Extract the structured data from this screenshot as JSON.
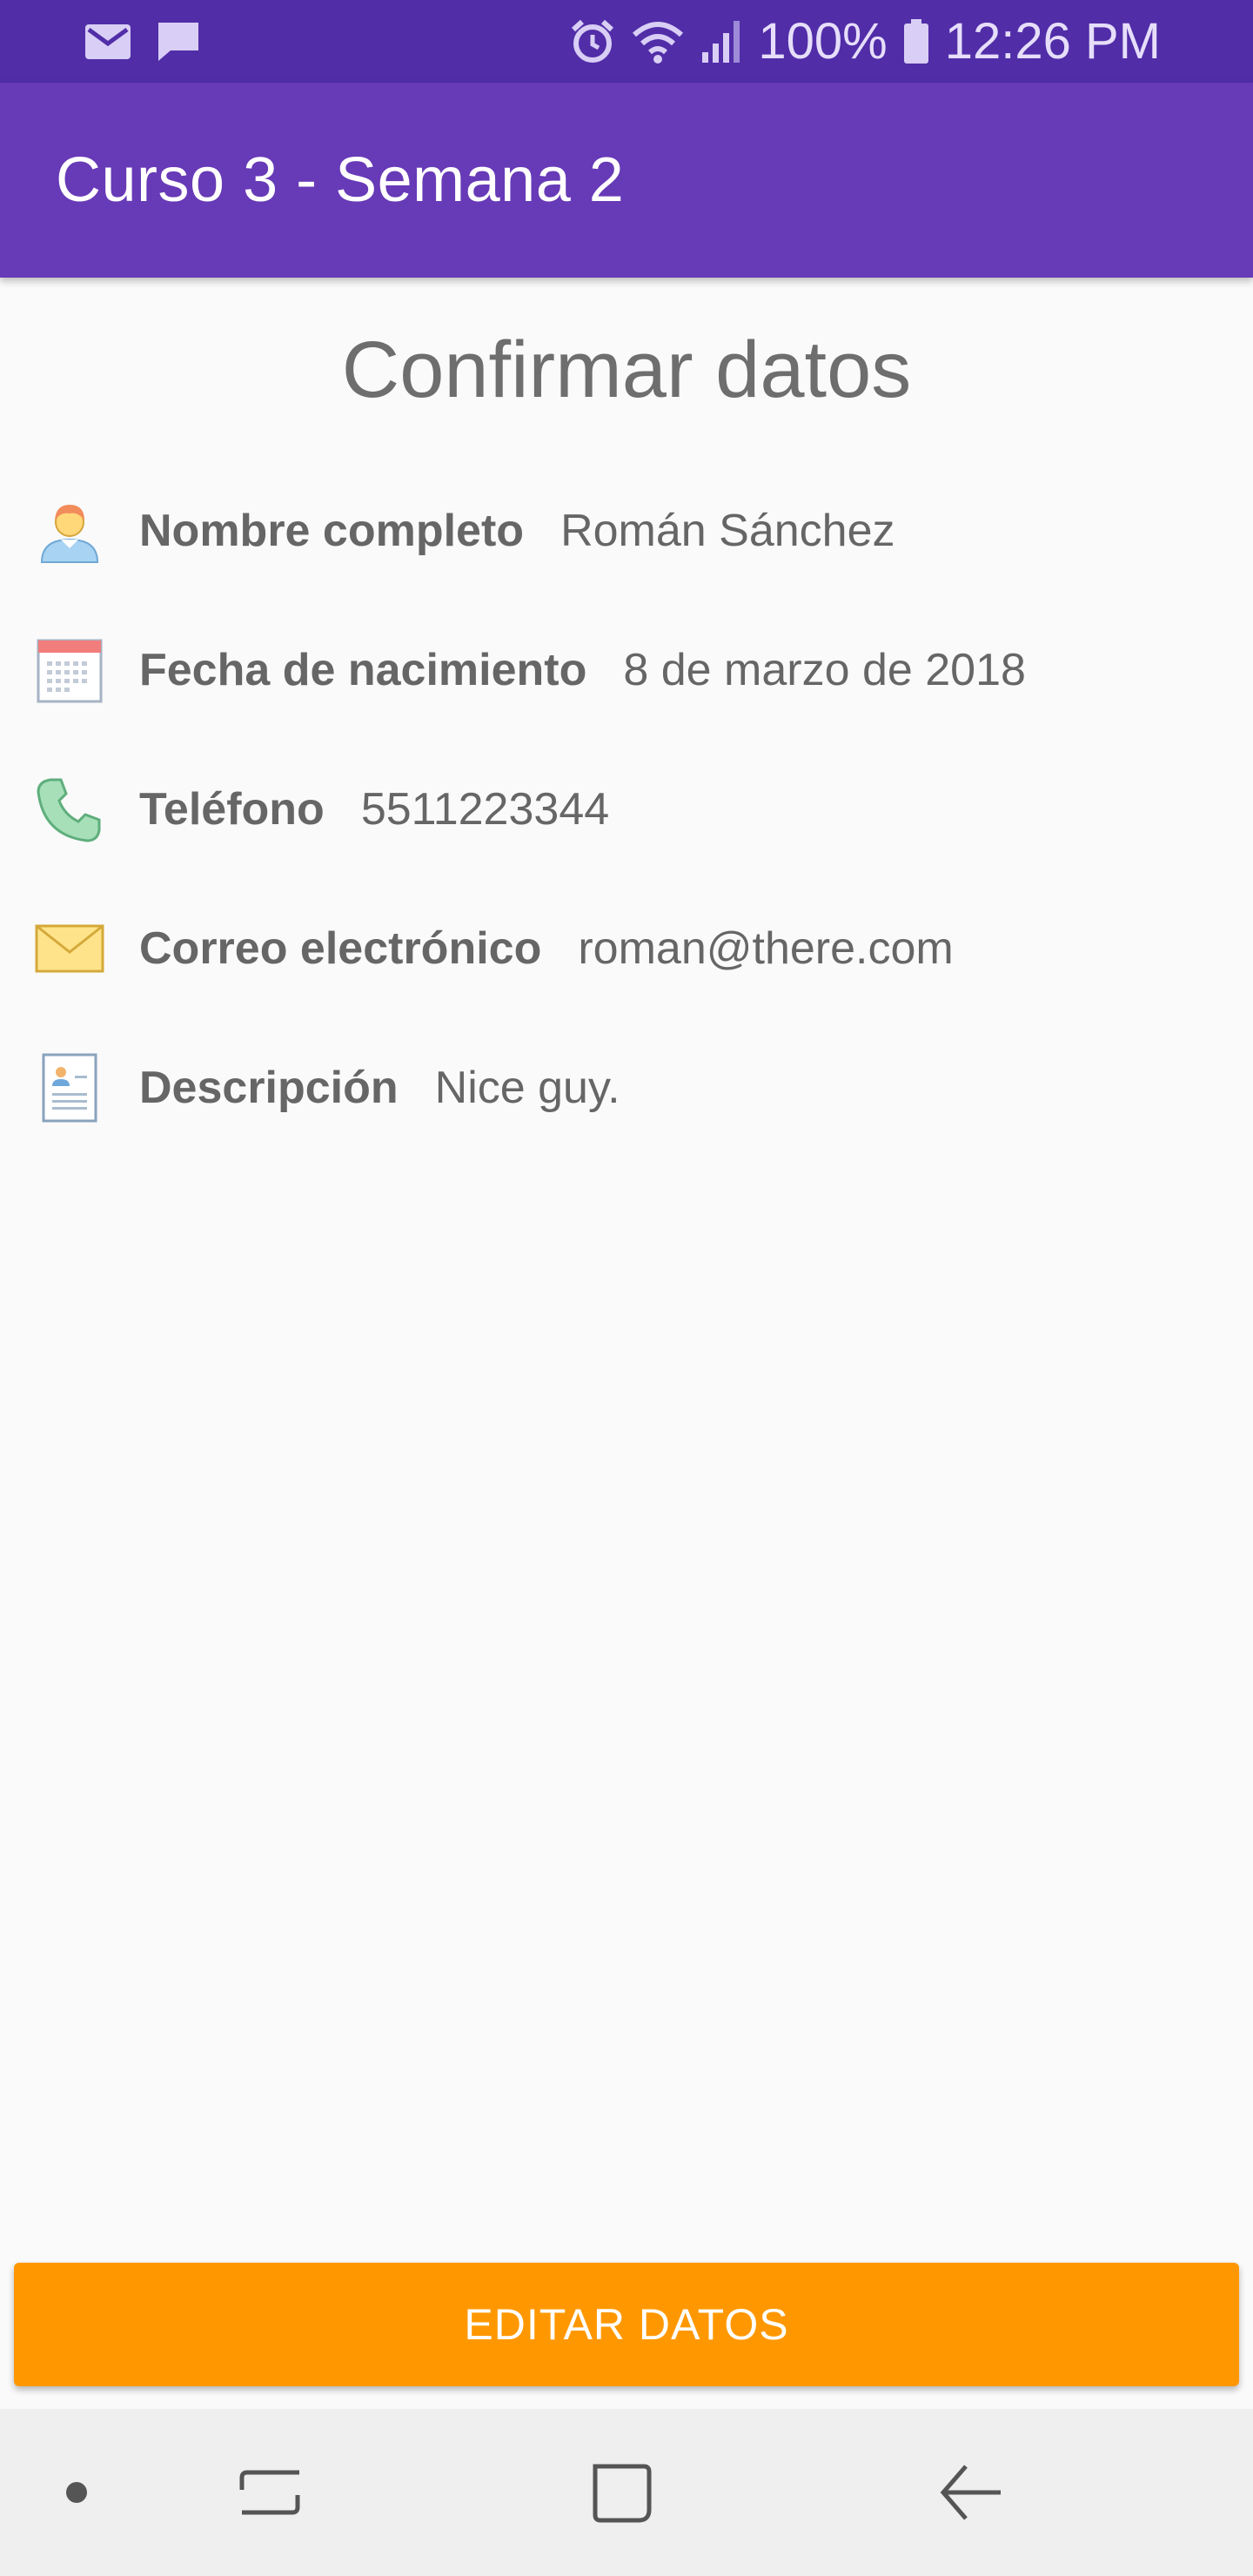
{
  "status_bar": {
    "battery": "100%",
    "time": "12:26 PM",
    "left_icons": [
      "mail-icon",
      "message-icon"
    ],
    "right_icons": [
      "alarm-icon",
      "wifi-icon",
      "signal-icon",
      "battery-icon"
    ]
  },
  "app_bar": {
    "title": "Curso 3 - Semana 2"
  },
  "main": {
    "heading": "Confirmar datos",
    "fields": [
      {
        "icon": "user-icon",
        "label": "Nombre completo",
        "value": "Román Sánchez"
      },
      {
        "icon": "calendar-icon",
        "label": "Fecha de nacimiento",
        "value": "8 de marzo de 2018"
      },
      {
        "icon": "phone-icon",
        "label": "Teléfono",
        "value": "5511223344"
      },
      {
        "icon": "envelope-icon",
        "label": "Correo electrónico",
        "value": "roman@there.com"
      },
      {
        "icon": "contact-card-icon",
        "label": "Descripción",
        "value": "Nice guy."
      }
    ],
    "edit_button_label": "EDITAR DATOS"
  },
  "nav_bar": {
    "items": [
      "dot-icon",
      "recent-apps-icon",
      "home-icon",
      "back-icon"
    ]
  },
  "colors": {
    "status_bar": "#512da8",
    "app_bar": "#673ab7",
    "accent_button": "#ff9800",
    "background": "#fafafa",
    "text": "#666666"
  }
}
